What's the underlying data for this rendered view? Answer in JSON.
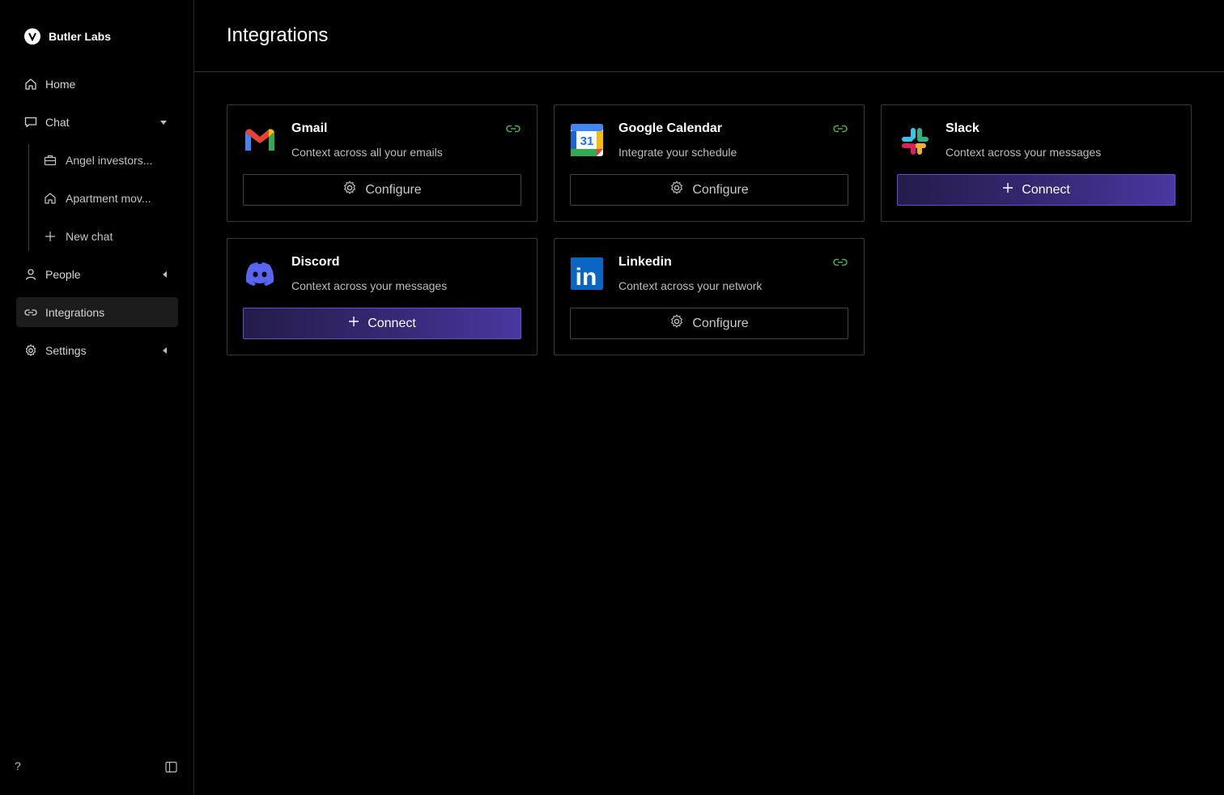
{
  "brand": {
    "name": "Butler Labs"
  },
  "sidebar": {
    "items": [
      {
        "label": "Home",
        "icon": "home-icon"
      },
      {
        "label": "Chat",
        "icon": "chat-icon"
      },
      {
        "label": "People",
        "icon": "person-icon"
      },
      {
        "label": "Integrations",
        "icon": "link-icon"
      },
      {
        "label": "Settings",
        "icon": "gear-icon"
      }
    ],
    "chat_children": [
      {
        "label": "Angel investors...",
        "icon": "briefcase-icon"
      },
      {
        "label": "Apartment mov...",
        "icon": "home-icon"
      },
      {
        "label": "New chat",
        "icon": "plus-icon"
      }
    ],
    "footer_help": "?"
  },
  "header": {
    "title": "Integrations"
  },
  "integrations": [
    {
      "name": "Gmail",
      "description": "Context across all your emails",
      "connected": true,
      "action": "Configure",
      "logo": "gmail-logo"
    },
    {
      "name": "Google Calendar",
      "description": "Integrate your schedule",
      "connected": true,
      "action": "Configure",
      "logo": "google-calendar-logo",
      "logo_text": "31"
    },
    {
      "name": "Slack",
      "description": "Context across your messages",
      "connected": false,
      "action": "Connect",
      "logo": "slack-logo"
    },
    {
      "name": "Discord",
      "description": "Context across your messages",
      "connected": false,
      "action": "Connect",
      "logo": "discord-logo"
    },
    {
      "name": "Linkedin",
      "description": "Context across your network",
      "connected": true,
      "action": "Configure",
      "logo": "linkedin-logo",
      "logo_text": "in"
    }
  ],
  "colors": {
    "accent": "#4a38a0",
    "connected_green": "#4caf50",
    "background": "#000000"
  }
}
